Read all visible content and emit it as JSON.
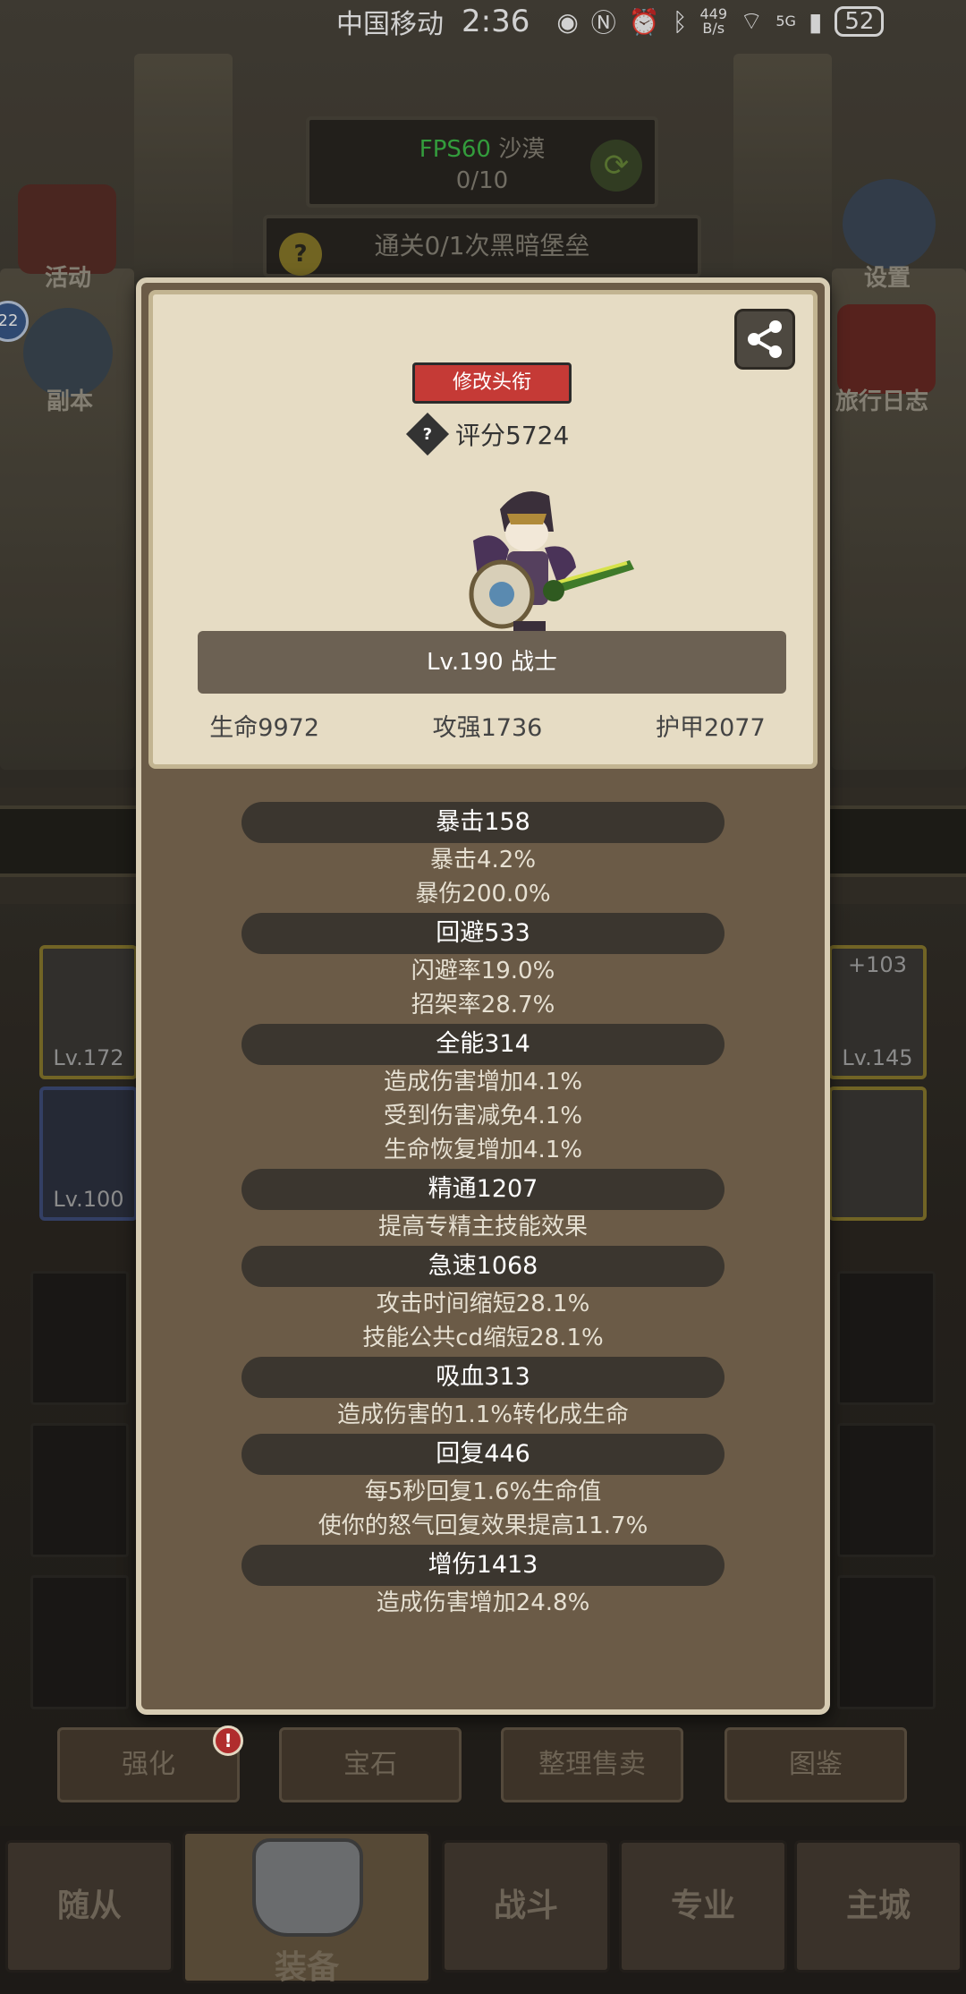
{
  "status_bar": {
    "carrier": "中国移动",
    "time": "2:36",
    "net_speed_top": "449",
    "net_speed_bottom": "B/s",
    "signal_label": "5G",
    "battery": "52"
  },
  "hud": {
    "fps": "FPS60",
    "zone": "沙漠",
    "progress": "0/10",
    "quest": "通关0/1次黑暗堡垒",
    "left_icons": [
      "活动",
      "副本"
    ],
    "right_icons": [
      "设置",
      "旅行日志"
    ],
    "level_badge": "22"
  },
  "slots": {
    "left_top": "Lv.172",
    "left_bottom": "Lv.100",
    "right_top": "Lv.145",
    "right_top_plus": "+103"
  },
  "profile": {
    "edit_title_button": "修改头衔",
    "score": "评分5724",
    "level_class": "Lv.190 战士",
    "stats": [
      "生命9972",
      "攻强1736",
      "护甲2077"
    ]
  },
  "attributes": [
    {
      "header": "暴击158",
      "lines": [
        "暴击4.2%",
        "暴伤200.0%"
      ]
    },
    {
      "header": "回避533",
      "lines": [
        "闪避率19.0%",
        "招架率28.7%"
      ]
    },
    {
      "header": "全能314",
      "lines": [
        "造成伤害增加4.1%",
        "受到伤害减免4.1%",
        "生命恢复增加4.1%"
      ]
    },
    {
      "header": "精通1207",
      "lines": [
        "提高专精主技能效果"
      ]
    },
    {
      "header": "急速1068",
      "lines": [
        "攻击时间缩短28.1%",
        "技能公共cd缩短28.1%"
      ]
    },
    {
      "header": "吸血313",
      "lines": [
        "造成伤害的1.1%转化成生命"
      ]
    },
    {
      "header": "回复446",
      "lines": [
        "每5秒回复1.6%生命值",
        "使你的怒气回复效果提高11.7%"
      ]
    },
    {
      "header": "增伤1413",
      "lines": [
        "造成伤害增加24.8%"
      ]
    }
  ],
  "actions": [
    "强化",
    "宝石",
    "整理售卖",
    "图鉴"
  ],
  "nav": [
    "随从",
    "装备",
    "战斗",
    "专业",
    "主城"
  ]
}
